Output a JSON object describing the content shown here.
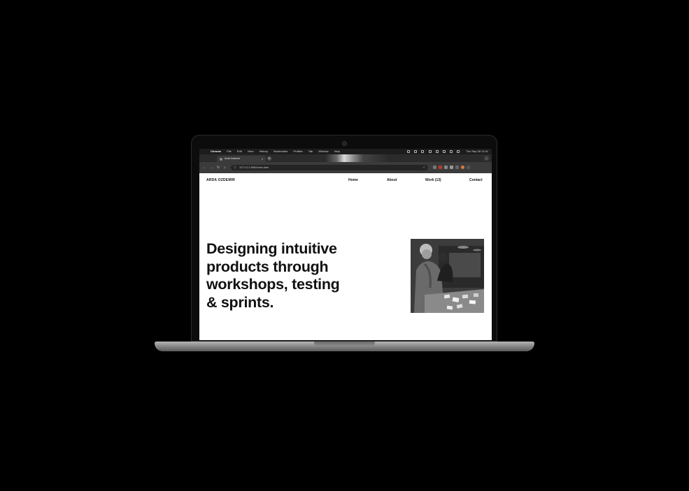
{
  "menubar": {
    "apple_glyph": "",
    "menus": [
      "Chrome",
      "File",
      "Edit",
      "View",
      "History",
      "Bookmarks",
      "Profiles",
      "Tab",
      "Window",
      "Help"
    ],
    "clock": "Thu Sep 28  12:41"
  },
  "browser": {
    "tab_title": "Arda Ozdemir",
    "tab_close": "×",
    "new_tab": "+",
    "tab_search": "⌄",
    "url": "127.0.0.1:5500/view.html",
    "back": "←",
    "forward": "→",
    "reload": "↻",
    "home": "⌂",
    "lock": "ⓘ",
    "star": "☆"
  },
  "site": {
    "brand": "ARDA OZDEMIR",
    "nav": {
      "home": "Home",
      "about": "About",
      "work": "Work (13)",
      "contact": "Contact"
    },
    "headline_lines": [
      "Designing intuitive",
      "products through",
      "workshops, testing",
      "& sprints."
    ]
  },
  "colors": {
    "traffic_close": "#ff5f57",
    "traffic_minimize": "#febc2e",
    "traffic_zoom": "#28c840",
    "page_background": "#ffffff",
    "text": "#111111"
  },
  "dock": {
    "icons": [
      {
        "name": "finder-icon",
        "color": "#3d8ff7"
      },
      {
        "name": "launchpad-icon",
        "color": "#9aa4b5"
      },
      {
        "name": "mission-control-icon",
        "color": "#7c8597"
      },
      {
        "name": "messages-icon",
        "color": "#34c759"
      },
      {
        "name": "whatsapp-icon",
        "color": "#25d366"
      },
      {
        "name": "mail-icon",
        "color": "#4aa3f5"
      },
      {
        "name": "notes-icon",
        "color": "#f5d04a"
      },
      {
        "name": "calendar-icon",
        "color": "#f2f2f2"
      },
      {
        "name": "system-settings-icon",
        "color": "#8e8e93"
      },
      {
        "name": "photos-icon",
        "color": "#f59b3c"
      },
      {
        "name": "chrome-icon",
        "color": "#4285f4"
      },
      {
        "name": "reminders-icon",
        "color": "#f0f0f0"
      },
      {
        "name": "spotify-icon",
        "color": "#1db954"
      },
      {
        "name": "figma-icon",
        "color": "#a259ff"
      },
      {
        "name": "photoshop-icon",
        "color": "#31a8ff"
      },
      {
        "name": "xcode-icon",
        "color": "#1c7cd6"
      },
      {
        "name": "app-store-icon",
        "color": "#2a8ef5"
      },
      {
        "name": "vlc-icon",
        "color": "#ff8800"
      },
      {
        "name": "calculator-icon",
        "color": "#555555"
      },
      {
        "name": "blender-icon",
        "color": "#e87d0d"
      },
      {
        "name": "sketch-icon",
        "color": "#fdb300"
      },
      {
        "name": "slack-icon",
        "color": "#4a154b"
      },
      {
        "name": "dropbox-icon",
        "color": "#0061ff"
      },
      {
        "name": "notion-icon",
        "color": "#ffffff"
      },
      {
        "name": "vscode-icon",
        "color": "#1f9cf0"
      }
    ],
    "trailing": [
      {
        "name": "downloads-folder-icon",
        "color": "#5aa9f5"
      },
      {
        "name": "trash-icon",
        "color": "#9a9a9a"
      }
    ]
  }
}
